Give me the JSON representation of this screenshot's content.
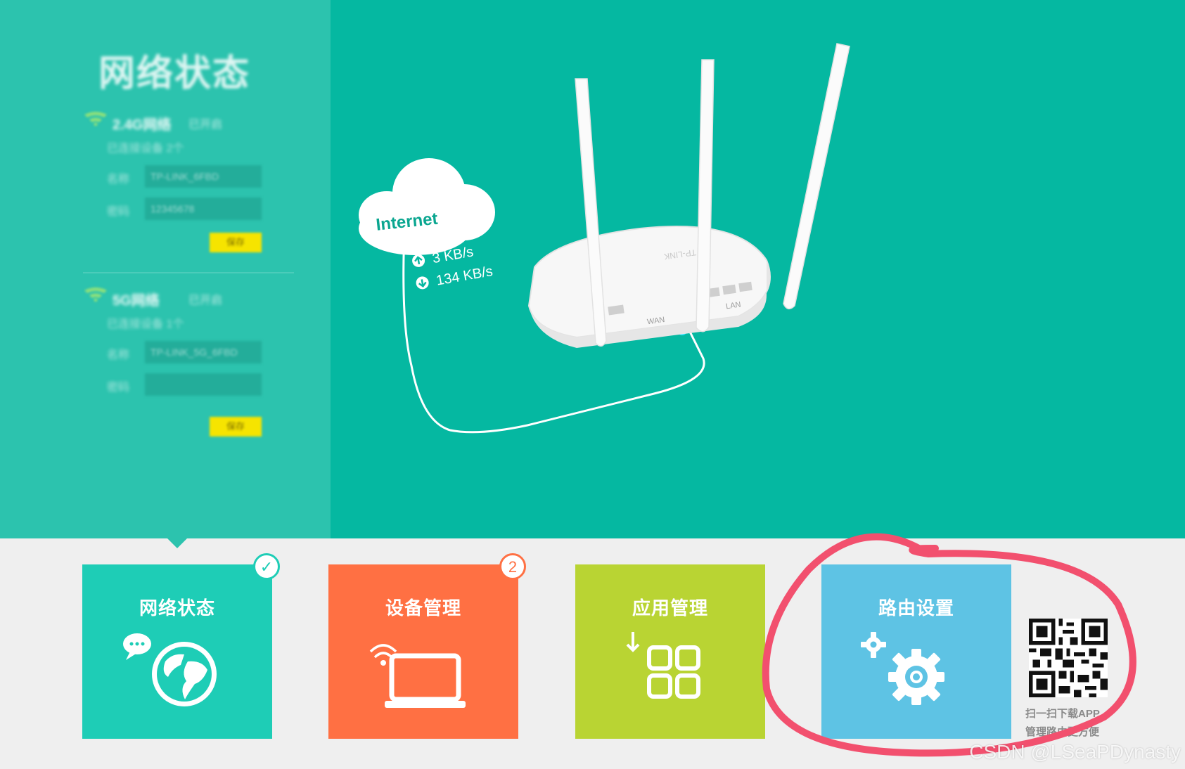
{
  "status_panel": {
    "title": "网络状态",
    "networks": [
      {
        "name": "2.4G网络",
        "sub": "已开启",
        "line1": "已连接设备 2个",
        "field1_label": "名称",
        "field1_value": "TP-LINK_6FBD",
        "field2_label": "密码",
        "field2_value": "12345678",
        "button": "保存"
      },
      {
        "name": "5G网络",
        "sub": "已开启",
        "line1": "已连接设备 1个",
        "field1_label": "名称",
        "field1_value": "TP-LINK_5G_6FBD",
        "field2_label": "密码",
        "field2_value": "",
        "button": "保存"
      }
    ]
  },
  "illustration": {
    "cloud_label": "Internet",
    "upload_speed": "3 KB/s",
    "download_speed": "134 KB/s",
    "brand_label": "TP-LINK",
    "wan_label": "WAN",
    "lan_label": "LAN"
  },
  "tiles": [
    {
      "label": "网络状态",
      "icon": "globe-chat-icon",
      "color": "#1ecdb6",
      "badge": "check"
    },
    {
      "label": "设备管理",
      "icon": "laptop-wifi-icon",
      "color": "#ff7043",
      "badge": "2"
    },
    {
      "label": "应用管理",
      "icon": "apps-grid-icon",
      "color": "#b9d433",
      "badge": ""
    },
    {
      "label": "路由设置",
      "icon": "gears-icon",
      "color": "#5ec3e4",
      "badge": ""
    }
  ],
  "qr": {
    "line1": "扫一扫下载APP",
    "line2": "管理路由更方便"
  },
  "watermark": "CSDN @LSeaPDynasty",
  "colors": {
    "hero_bg": "#05b8a1",
    "panel_bg": "#2cc3ae",
    "bottom_bg": "#efefef",
    "highlight_circle": "#f2506e"
  }
}
